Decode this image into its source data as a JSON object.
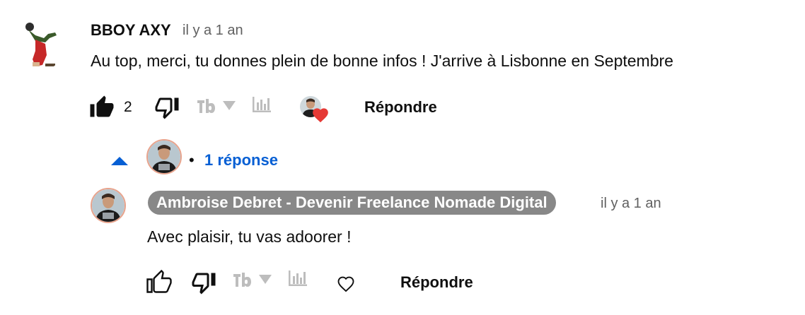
{
  "comment": {
    "author": "BBOY AXY",
    "time": "il y a 1 an",
    "text": "Au top, merci, tu donnes plein de bonne infos ! J'arrive à Lisbonne en Septembre",
    "like_count": "2",
    "reply_label": "Répondre",
    "icons": [
      "thumb-up-filled-icon",
      "thumb-down-icon",
      "tubebuddy-icon",
      "caret-down-icon",
      "stats-icon",
      "creator-heart-icon"
    ]
  },
  "replies_toggle": {
    "label": "1 réponse",
    "bullet": "•",
    "accent": "#065fd4"
  },
  "reply": {
    "author": "Ambroise Debret - Devenir Freelance Nomade Digital",
    "time": "il y a 1 an",
    "text": "Avec plaisir, tu vas adoorer !",
    "reply_label": "Répondre",
    "icons": [
      "thumb-up-icon",
      "thumb-down-icon",
      "tubebuddy-icon",
      "caret-down-icon",
      "stats-icon",
      "heart-outline-icon"
    ]
  },
  "colors": {
    "heart": "#e53935",
    "author_pill": "#888888",
    "secondary_text": "#606060"
  }
}
